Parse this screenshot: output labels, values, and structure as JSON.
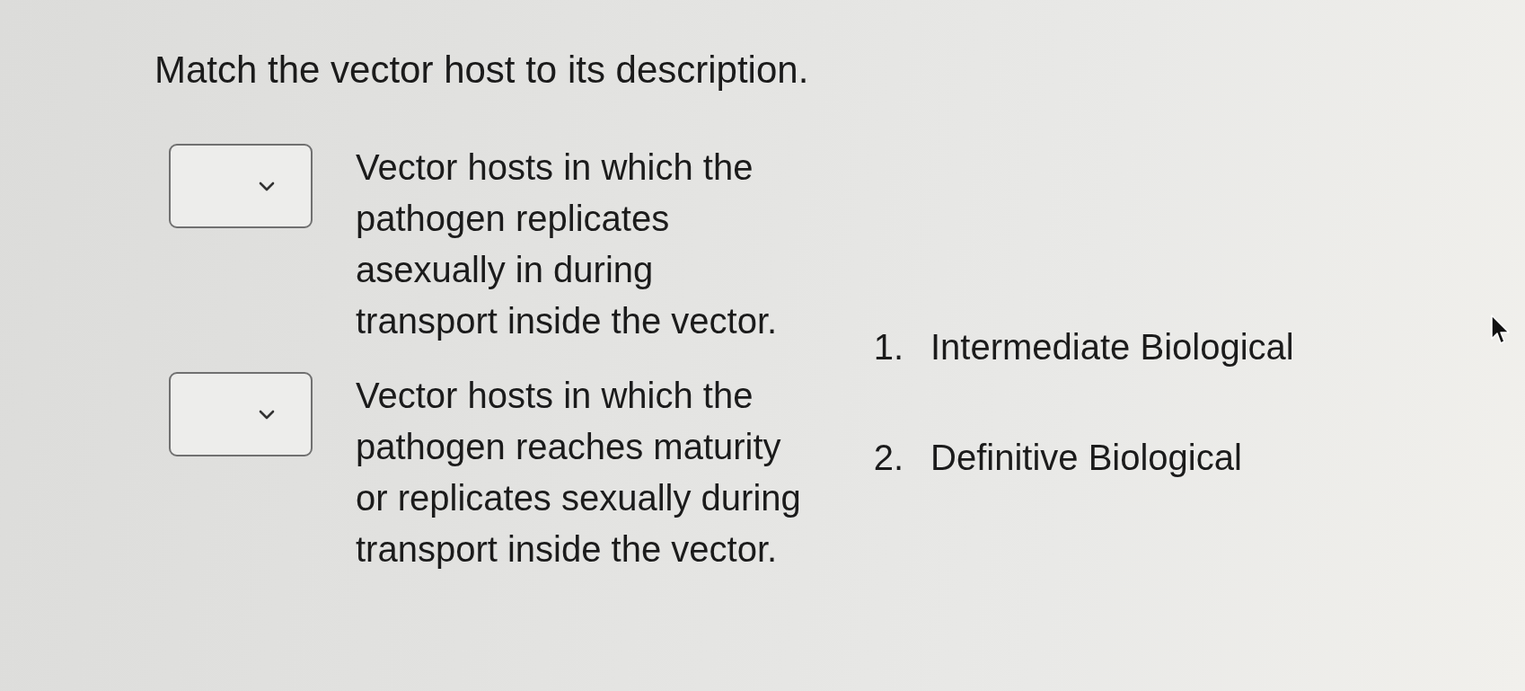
{
  "question": "Match the vector host to its description.",
  "matches": [
    {
      "description": "Vector hosts in which the pathogen replicates asexually in during transport inside the vector."
    },
    {
      "description": "Vector hosts in which the pathogen reaches maturity or replicates sexually during transport inside the vector."
    }
  ],
  "answers": [
    {
      "number": "1.",
      "label": "Intermediate Biological"
    },
    {
      "number": "2.",
      "label": "Definitive Biological"
    }
  ]
}
